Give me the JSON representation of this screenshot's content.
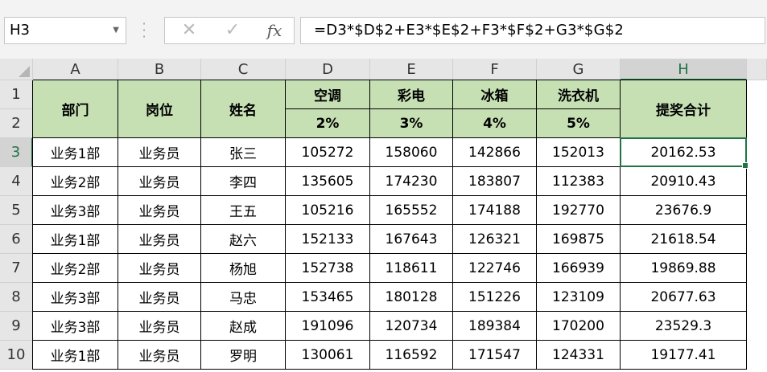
{
  "formula_bar": {
    "name_box": "H3",
    "cancel_icon": "✕",
    "enter_icon": "✓",
    "fx_label": "fx",
    "formula": "=D3*$D$2+E3*$E$2+F3*$F$2+G3*$G$2"
  },
  "columns": [
    "A",
    "B",
    "C",
    "D",
    "E",
    "F",
    "G",
    "H"
  ],
  "rows": [
    "1",
    "2",
    "3",
    "4",
    "5",
    "6",
    "7",
    "8",
    "9",
    "10"
  ],
  "selected_cell": "H3",
  "header": {
    "dept": "部门",
    "position": "岗位",
    "name": "姓名",
    "ac": "空调",
    "tv": "彩电",
    "fridge": "冰箱",
    "washer": "洗衣机",
    "total": "提奖合计",
    "ac_rate": "2%",
    "tv_rate": "3%",
    "fridge_rate": "4%",
    "washer_rate": "5%"
  },
  "data": [
    [
      "业务1部",
      "业务员",
      "张三",
      "105272",
      "158060",
      "142866",
      "152013",
      "20162.53"
    ],
    [
      "业务2部",
      "业务员",
      "李四",
      "135605",
      "174230",
      "183807",
      "112383",
      "20910.43"
    ],
    [
      "业务3部",
      "业务员",
      "王五",
      "105216",
      "165552",
      "174188",
      "192770",
      "23676.9"
    ],
    [
      "业务1部",
      "业务员",
      "赵六",
      "152133",
      "167643",
      "126321",
      "169875",
      "21618.54"
    ],
    [
      "业务2部",
      "业务员",
      "杨旭",
      "152738",
      "118611",
      "122746",
      "166939",
      "19869.88"
    ],
    [
      "业务3部",
      "业务员",
      "马忠",
      "153465",
      "180128",
      "151226",
      "123109",
      "20677.63"
    ],
    [
      "业务3部",
      "业务员",
      "赵成",
      "191096",
      "120734",
      "189384",
      "170200",
      "23529.3"
    ],
    [
      "业务1部",
      "业务员",
      "罗明",
      "130061",
      "116592",
      "171547",
      "124331",
      "19177.41"
    ]
  ],
  "colors": {
    "header_fill": "#c6e0b4",
    "selection": "#217346"
  }
}
